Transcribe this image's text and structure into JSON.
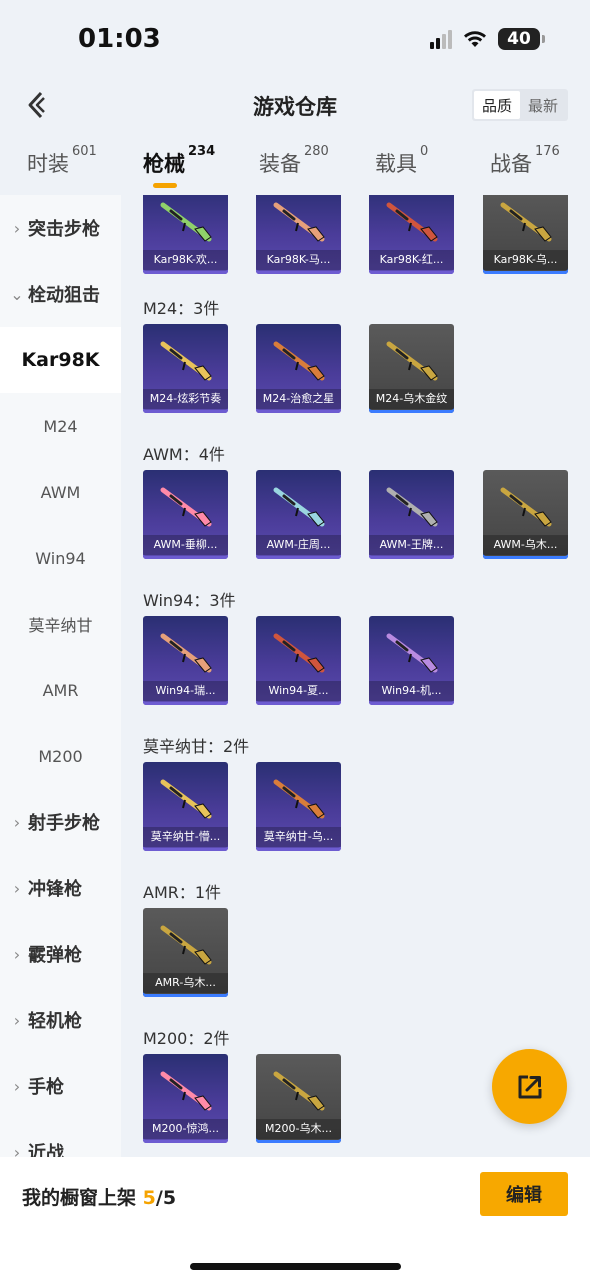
{
  "status": {
    "time": "01:03",
    "battery": "40"
  },
  "header": {
    "title": "游戏仓库",
    "sort_options": [
      "品质",
      "最新"
    ]
  },
  "tabs": [
    {
      "label": "时装",
      "count": "601"
    },
    {
      "label": "枪械",
      "count": "234"
    },
    {
      "label": "装备",
      "count": "280"
    },
    {
      "label": "载具",
      "count": "0"
    },
    {
      "label": "战备",
      "count": "176"
    }
  ],
  "sidebar": {
    "categories_top": [
      "突击步枪",
      "栓动狙击"
    ],
    "subcategories": [
      "Kar98K",
      "M24",
      "AWM",
      "Win94",
      "莫辛纳甘",
      "AMR",
      "M200"
    ],
    "categories_bottom": [
      "射手步枪",
      "冲锋枪",
      "霰弹枪",
      "轻机枪",
      "手枪",
      "近战"
    ]
  },
  "sections": [
    {
      "title": "",
      "items": [
        {
          "name": "Kar98K-欢...",
          "rarity": "purple"
        },
        {
          "name": "Kar98K-马...",
          "rarity": "purple"
        },
        {
          "name": "Kar98K-红...",
          "rarity": "purple"
        },
        {
          "name": "Kar98K-乌...",
          "rarity": "gray"
        }
      ]
    },
    {
      "title": "M24：3件",
      "items": [
        {
          "name": "M24-炫彩节奏",
          "rarity": "purple"
        },
        {
          "name": "M24-治愈之星",
          "rarity": "purple"
        },
        {
          "name": "M24-乌木金纹",
          "rarity": "gray"
        }
      ]
    },
    {
      "title": "AWM：4件",
      "items": [
        {
          "name": "AWM-垂柳...",
          "rarity": "purple"
        },
        {
          "name": "AWM-庄周...",
          "rarity": "purple"
        },
        {
          "name": "AWM-王牌...",
          "rarity": "purple"
        },
        {
          "name": "AWM-乌木...",
          "rarity": "gray"
        }
      ]
    },
    {
      "title": "Win94：3件",
      "items": [
        {
          "name": "Win94-瑞...",
          "rarity": "purple"
        },
        {
          "name": "Win94-夏...",
          "rarity": "purple"
        },
        {
          "name": "Win94-机...",
          "rarity": "purple"
        }
      ]
    },
    {
      "title": "莫辛纳甘：2件",
      "items": [
        {
          "name": "莫辛纳甘-懵...",
          "rarity": "purple"
        },
        {
          "name": "莫辛纳甘-乌...",
          "rarity": "purple"
        }
      ]
    },
    {
      "title": "AMR：1件",
      "items": [
        {
          "name": "AMR-乌木...",
          "rarity": "gray"
        }
      ]
    },
    {
      "title": "M200：2件",
      "items": [
        {
          "name": "M200-惊鸿...",
          "rarity": "purple"
        },
        {
          "name": "M200-乌木...",
          "rarity": "gray"
        }
      ]
    }
  ],
  "bottom": {
    "showcase_label": "我的橱窗上架",
    "showcase_count": "5",
    "showcase_total": "/5",
    "edit_label": "编辑"
  },
  "colors": {
    "accent": "#f7a800",
    "purple_card": "#4a3c99",
    "gray_card": "#4d4d4d"
  }
}
